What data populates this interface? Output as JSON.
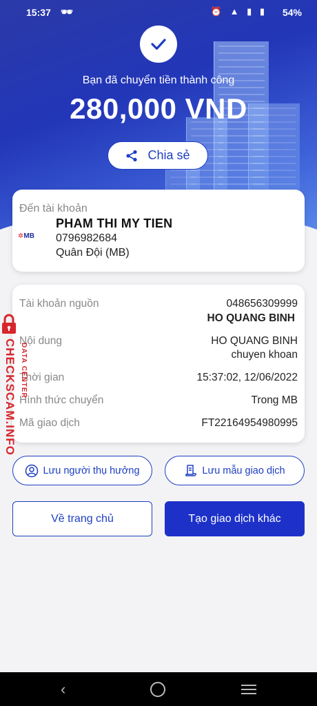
{
  "status_bar": {
    "time": "15:37",
    "battery": "54%"
  },
  "hero": {
    "success_message": "Bạn đã chuyển tiền thành công",
    "amount": "280,000 VND",
    "share_label": "Chia sẻ"
  },
  "recipient": {
    "section_label": "Đến tài khoản",
    "bank_logo_text": "MB",
    "name": "PHAM THI MY TIEN",
    "account_number": "0796982684",
    "bank_name": "Quân Đội (MB)"
  },
  "details": {
    "source_label": "Tài khoản nguồn",
    "source_account": "048656309999",
    "source_name": "HO QUANG BINH",
    "content_label": "Nội dung",
    "content_line1": "HO QUANG BINH",
    "content_line2": "chuyen khoan",
    "time_label": "Thời gian",
    "time_value": "15:37:02, 12/06/2022",
    "method_label": "Hình thức chuyển",
    "method_value": "Trong MB",
    "txn_label": "Mã giao dịch",
    "txn_value": "FT22164954980995"
  },
  "actions": {
    "save_payee": "Lưu người thụ hưởng",
    "save_template": "Lưu mẫu giao dịch",
    "home": "Về trang chủ",
    "new_transaction": "Tạo giao dịch khác"
  },
  "watermark": {
    "site": "CHECKSCAM.INFO",
    "tag": "DATA CENTER"
  },
  "colors": {
    "primary": "#1d31c9",
    "accent_red": "#d7262c"
  }
}
